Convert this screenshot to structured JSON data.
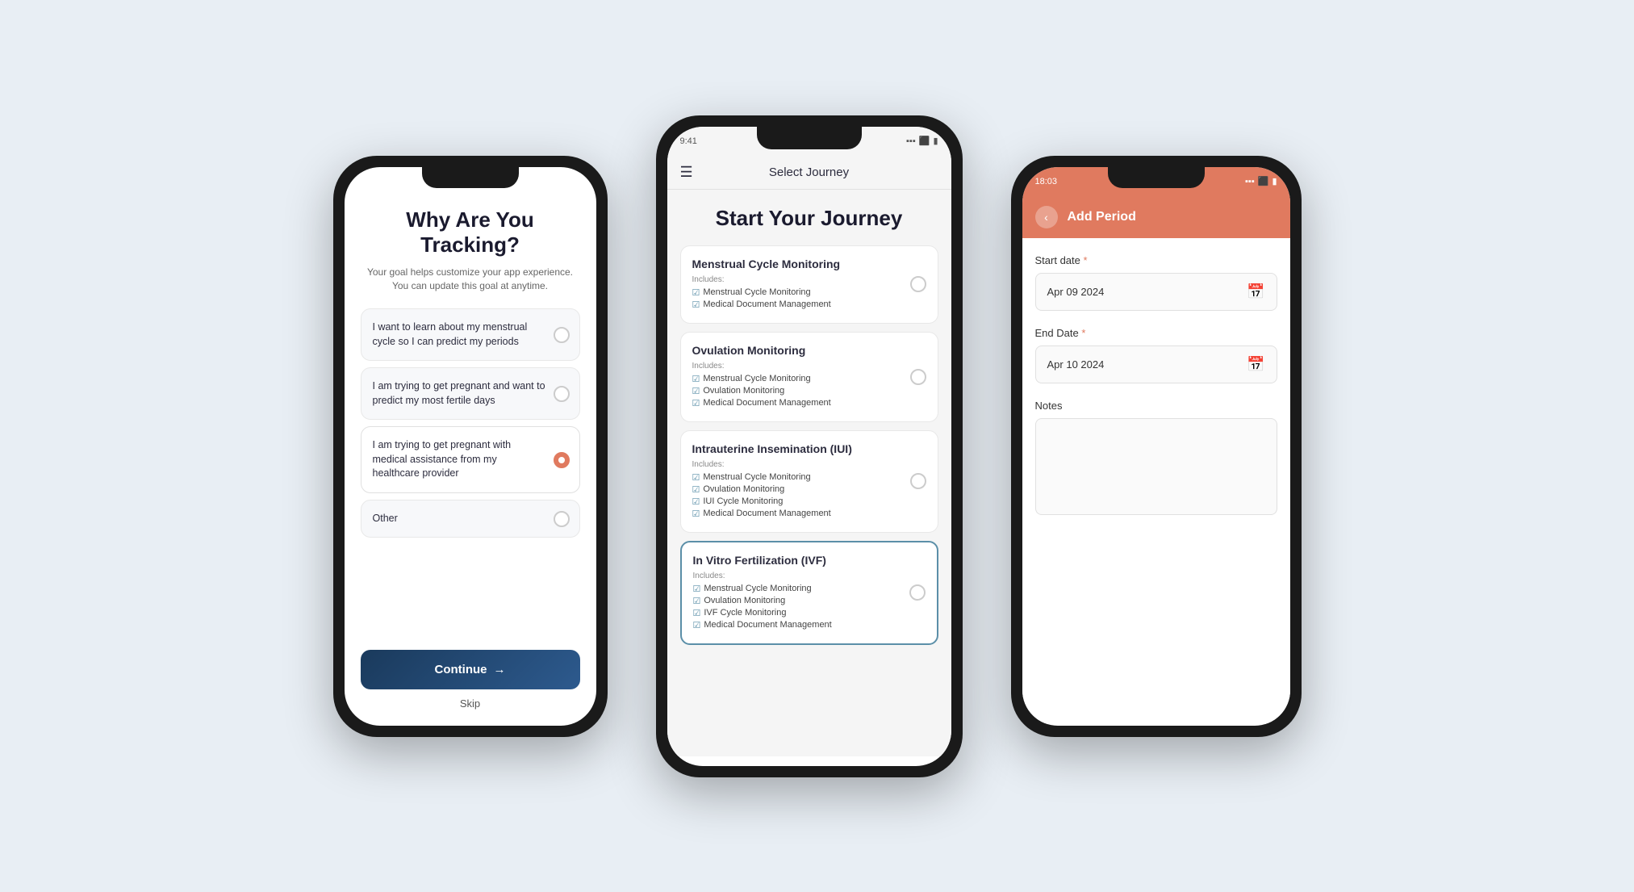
{
  "phone1": {
    "title": "Why Are You Tracking?",
    "subtitle": "Your goal helps customize your app experience.\nYou can update this goal at anytime.",
    "options": [
      {
        "id": "learn",
        "text": "I want to learn about my menstrual cycle so I can predict my periods",
        "selected": false
      },
      {
        "id": "fertile",
        "text": "I am trying to get pregnant and want to predict my most fertile days",
        "selected": false
      },
      {
        "id": "medical",
        "text": "I am trying to get pregnant with medical assistance from my healthcare provider",
        "selected": true
      },
      {
        "id": "other",
        "text": "Other",
        "selected": false
      }
    ],
    "continue_label": "Continue",
    "skip_label": "Skip"
  },
  "phone2": {
    "status_time": "9:41",
    "header_title": "Select Journey",
    "page_title": "Start Your Journey",
    "journeys": [
      {
        "id": "menstrual",
        "title": "Menstrual Cycle Monitoring",
        "includes_label": "Includes:",
        "features": [
          "Menstrual Cycle Monitoring",
          "Medical Document Management"
        ],
        "selected": false
      },
      {
        "id": "ovulation",
        "title": "Ovulation Monitoring",
        "includes_label": "Includes:",
        "features": [
          "Menstrual Cycle Monitoring",
          "Ovulation Monitoring",
          "Medical Document Management"
        ],
        "selected": false
      },
      {
        "id": "iui",
        "title": "Intrauterine Insemination (IUI)",
        "includes_label": "Includes:",
        "features": [
          "Menstrual Cycle Monitoring",
          "Ovulation Monitoring",
          "IUI Cycle Monitoring",
          "Medical Document Management"
        ],
        "selected": false
      },
      {
        "id": "ivf",
        "title": "In Vitro Fertilization (IVF)",
        "includes_label": "Includes:",
        "features": [
          "Menstrual Cycle Monitoring",
          "Ovulation Monitoring",
          "IVF Cycle Monitoring",
          "Medical Document Management"
        ],
        "selected": false
      }
    ]
  },
  "phone3": {
    "status_time": "18:03",
    "header_title": "Add Period",
    "fields": {
      "start_date_label": "Start date",
      "start_date_value": "Apr 09 2024",
      "end_date_label": "End Date",
      "end_date_value": "Apr 10 2024",
      "notes_label": "Notes"
    }
  }
}
